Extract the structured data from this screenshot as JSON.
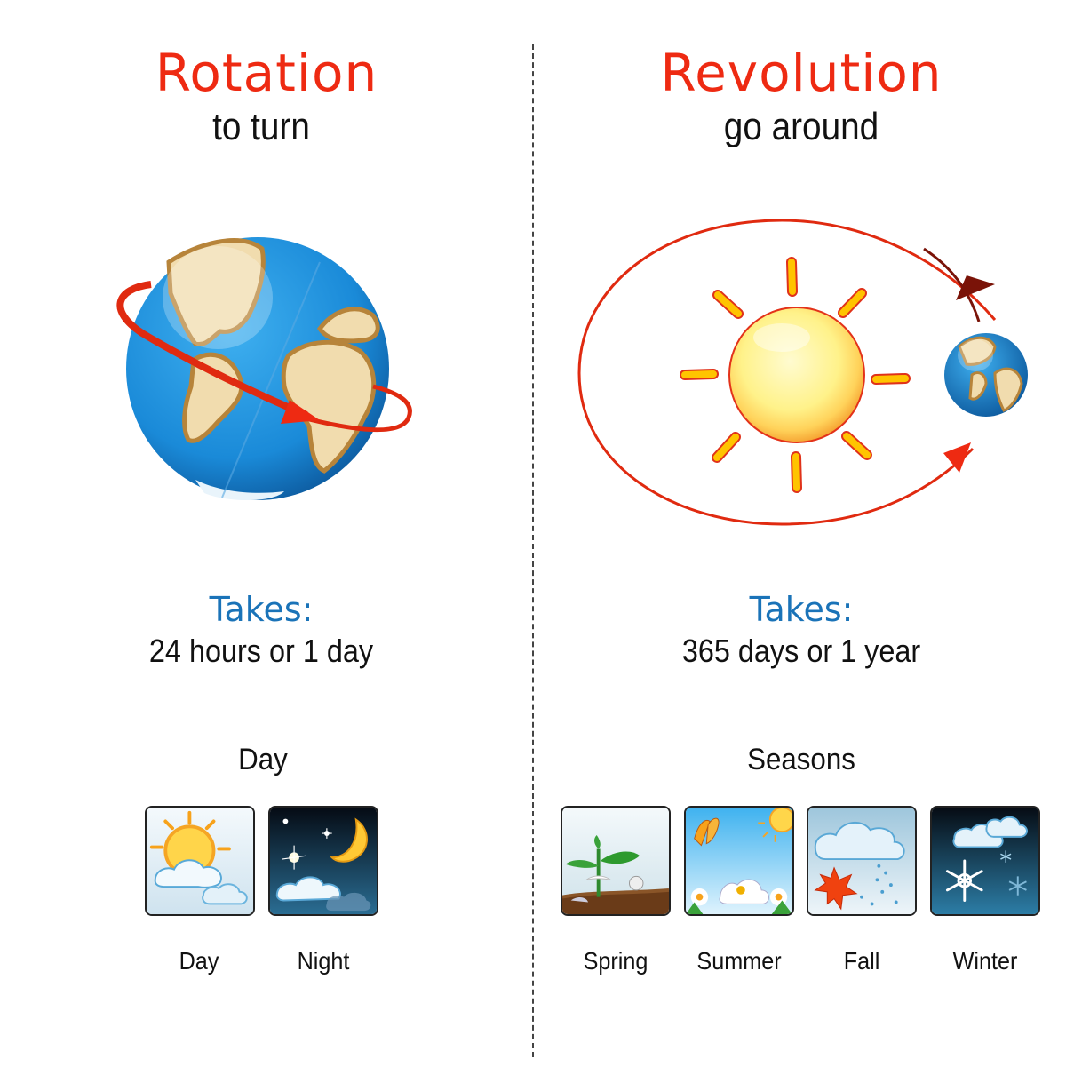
{
  "rotation": {
    "title": "Rotation",
    "subtitle": "to turn",
    "takes_label": "Takes:",
    "duration": "24 hours or 1 day",
    "section_title": "Day",
    "tiles": [
      {
        "label": "Day",
        "icon": "sun-behind-clouds-icon"
      },
      {
        "label": "Night",
        "icon": "moon-stars-clouds-icon"
      }
    ]
  },
  "revolution": {
    "title": "Revolution",
    "subtitle": "go around",
    "takes_label": "Takes:",
    "duration": "365 days or 1 year",
    "section_title": "Seasons",
    "tiles": [
      {
        "label": "Spring",
        "icon": "sprout-icon"
      },
      {
        "label": "Summer",
        "icon": "flower-butterfly-sun-icon"
      },
      {
        "label": "Fall",
        "icon": "rain-cloud-leaf-icon"
      },
      {
        "label": "Winter",
        "icon": "snowflake-clouds-icon"
      }
    ]
  },
  "colors": {
    "title_red": "#ee2a12",
    "takes_blue": "#1a73b8",
    "orbit_red": "#e02a10",
    "ocean_blue": "#1b8fdc",
    "land_tan": "#f1dcae",
    "sun_yellow": "#ffd64a"
  }
}
